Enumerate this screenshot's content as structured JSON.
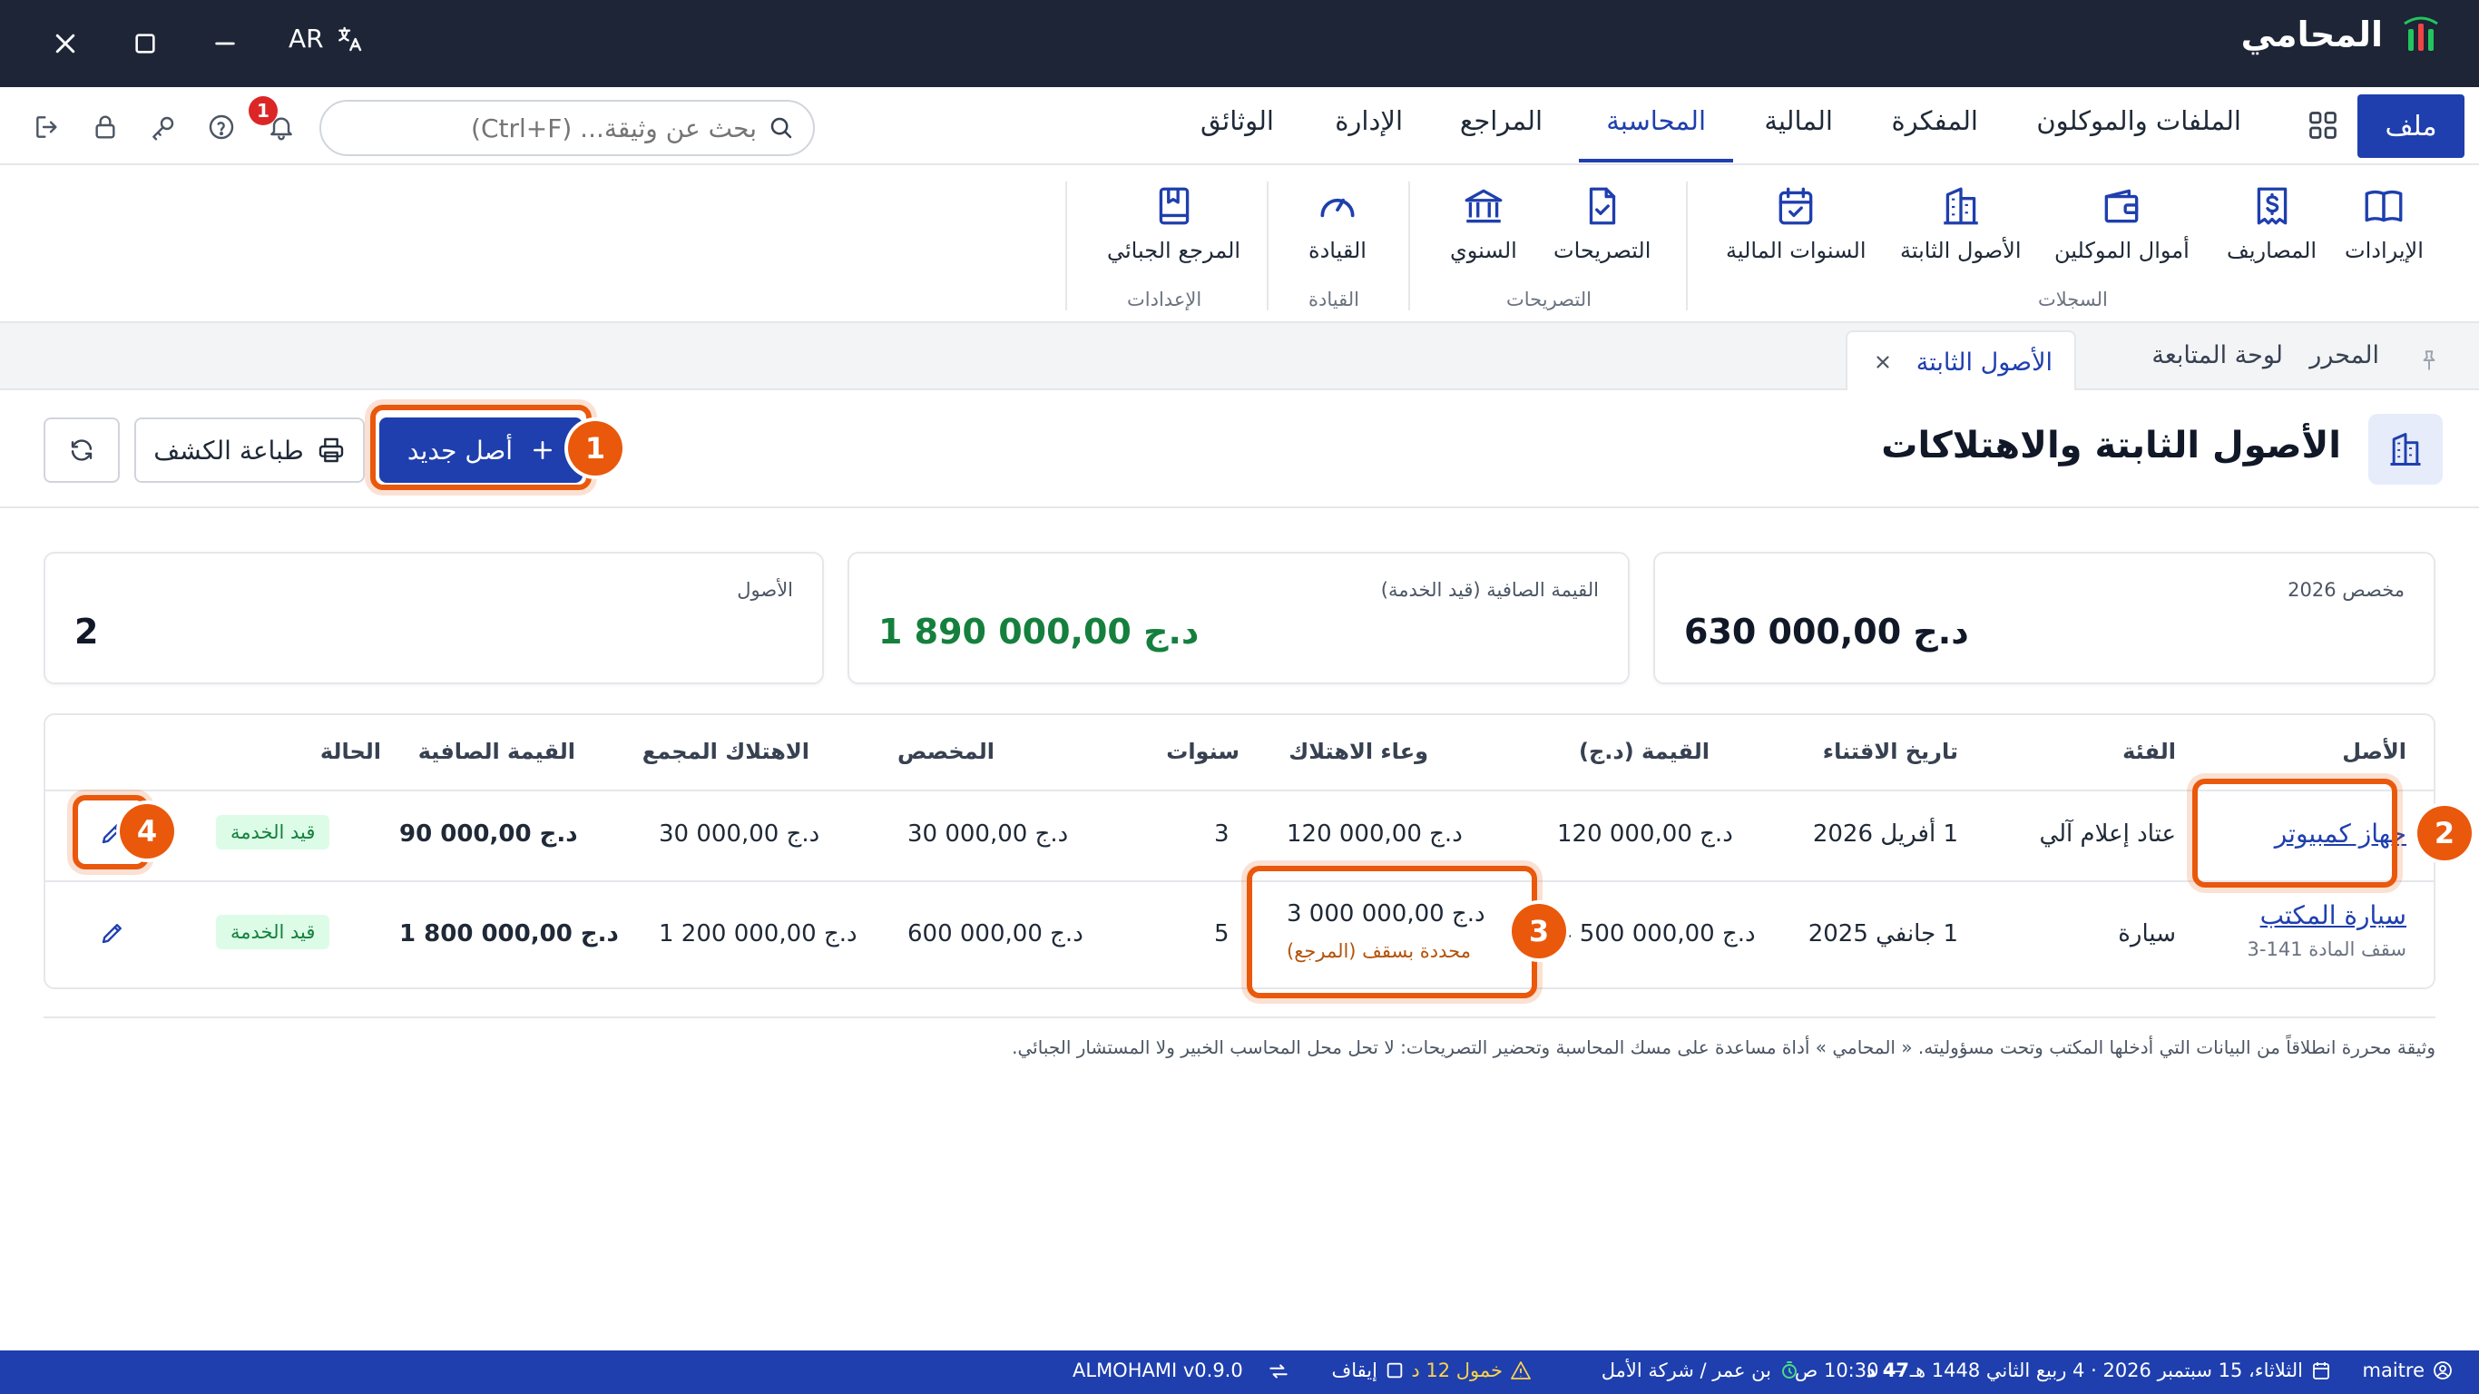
{
  "titlebar": {
    "app_name": "المحامي",
    "language": "AR",
    "colors": {
      "background": "#1d2536",
      "brand_green": "#22c55e",
      "brand_red": "#ef4444"
    }
  },
  "menubar": {
    "file_label": "ملف",
    "tabs": [
      {
        "label": "الملفات والموكلون"
      },
      {
        "label": "المفكرة"
      },
      {
        "label": "المالية"
      },
      {
        "label": "المحاسبة",
        "active": true
      },
      {
        "label": "المراجع"
      },
      {
        "label": "الإدارة"
      },
      {
        "label": "الوثائق"
      }
    ],
    "search": {
      "placeholder": "بحث عن وثيقة... (Ctrl+F)",
      "value": ""
    },
    "notification_count": "1",
    "accent": "#1f3fae"
  },
  "ribbon": {
    "items": [
      {
        "label": "الإيرادات",
        "icon": "open-book-icon"
      },
      {
        "label": "المصاريف",
        "icon": "dollar-receipt-icon"
      },
      {
        "label": "أموال الموكلين",
        "icon": "wallet-icon"
      },
      {
        "label": "الأصول الثابتة",
        "icon": "building-icon"
      },
      {
        "label": "السنوات المالية",
        "icon": "calendar-check-icon"
      },
      {
        "label": "التصريحات",
        "icon": "document-check-icon"
      },
      {
        "label": "السنوي",
        "icon": "bank-icon"
      },
      {
        "label": "القيادة",
        "icon": "gauge-icon"
      },
      {
        "label": "المرجع الجبائي",
        "icon": "bookmark-book-icon"
      }
    ],
    "groups": {
      "registers": "السجلات",
      "declarations": "التصريحات",
      "dashboard": "القيادة",
      "settings": "الإعدادات"
    }
  },
  "doc_tabs": {
    "editor": "المحرر",
    "dashboard": "لوحة المتابعة",
    "active": "الأصول الثابتة"
  },
  "page": {
    "title": "الأصول الثابتة والاهتلاكات",
    "new_button": "أصل جديد",
    "print_button": "طباعة الكشف"
  },
  "cards": [
    {
      "title": "مخصص 2026",
      "value": "630 000,00 د.ج"
    },
    {
      "title": "القيمة الصافية (قيد الخدمة)",
      "value": "1 890 000,00 د.ج",
      "color": "#15803d"
    },
    {
      "title": "الأصول",
      "value": "2"
    }
  ],
  "table": {
    "headers": {
      "asset": "الأصل",
      "category": "الفئة",
      "acquisition_date": "تاريخ الاقتناء",
      "value": "القيمة (د.ج)",
      "base": "وعاء الاهتلاك",
      "years": "سنوات",
      "allocation": "المخصص",
      "cumulative": "الاهتلاك المجمع",
      "net_value": "القيمة الصافية",
      "status": "الحالة"
    },
    "rows": [
      {
        "asset": "جهاز كمبيوتر",
        "category": "عتاد إعلام آلي",
        "acquisition_date": "1 أفريل 2026",
        "value": "120 000,00 د.ج",
        "base": "120 000,00 د.ج",
        "years": "3",
        "allocation": "30 000,00 د.ج",
        "cumulative": "30 000,00 د.ج",
        "net_value": "90 000,00 د.ج",
        "status": "قيد الخدمة"
      },
      {
        "asset": "سيارة المكتب",
        "asset_note": "سقف المادة 141-3",
        "category": "سيارة",
        "acquisition_date": "1 جانفي 2025",
        "value": "4 500 000,00 د.ج",
        "base": "3 000 000,00 د.ج",
        "base_note": "محددة بسقف (المرجع)",
        "years": "5",
        "allocation": "600 000,00 د.ج",
        "cumulative": "1 200 000,00 د.ج",
        "net_value": "1 800 000,00 د.ج",
        "status": "قيد الخدمة"
      }
    ]
  },
  "callouts": [
    "1",
    "2",
    "3",
    "4"
  ],
  "disclaimer": "وثيقة محررة انطلاقاً من البيانات التي أدخلها المكتب وتحت مسؤوليته. « المحامي » أداة مساعدة على مسك المحاسبة وتحضير التصريحات: لا تحل محل المحاسب الخبير ولا المستشار الجبائي.",
  "statusbar": {
    "user": "maitre",
    "datetime": "الثلاثاء، 15 سبتمبر 2026 · 4 ربيع الثاني 1448 هـ — 10:30 ص",
    "amount": "47 د",
    "client": "بن عمر / شركة الأمل",
    "warning": "خمول 12 د",
    "pause": "إيقاف",
    "version": "ALMOHAMI v0.9.0"
  }
}
